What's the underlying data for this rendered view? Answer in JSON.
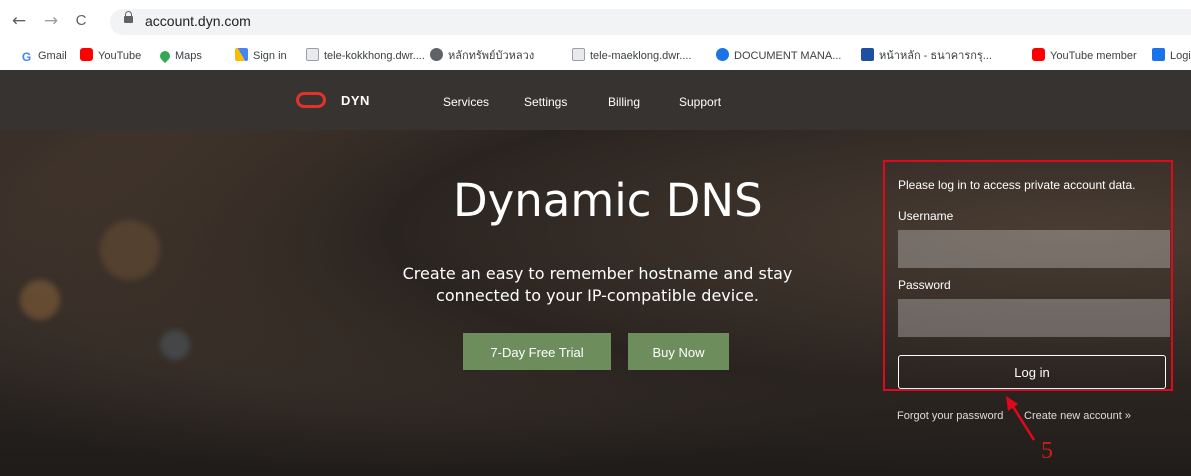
{
  "browser": {
    "url": "account.dyn.com",
    "nav": {
      "back": "←",
      "forward": "→",
      "reload": "C"
    }
  },
  "bookmarks": [
    {
      "label": "Gmail",
      "icon": "google-icon",
      "color": "#4285f4"
    },
    {
      "label": "YouTube",
      "icon": "youtube-icon",
      "color": "#ff0000"
    },
    {
      "label": "Maps",
      "icon": "maps-icon",
      "color": "#34a853"
    },
    {
      "label": "Sign in",
      "icon": "google-ads-icon",
      "color": "#4285f4"
    },
    {
      "label": "tele-kokkhong.dwr....",
      "icon": "document-icon",
      "color": "#9aa0a6"
    },
    {
      "label": "หลักทรัพย์บัวหลวง",
      "icon": "globe-icon",
      "color": "#5f6368"
    },
    {
      "label": "tele-maeklong.dwr....",
      "icon": "document-icon",
      "color": "#9aa0a6"
    },
    {
      "label": "DOCUMENT MANA...",
      "icon": "globe-icon",
      "color": "#1a73e8"
    },
    {
      "label": "หน้าหลัก - ธนาคารกรุ...",
      "icon": "bank-icon",
      "color": "#1e4fa0"
    },
    {
      "label": "YouTube member",
      "icon": "youtube-icon",
      "color": "#ff0000"
    },
    {
      "label": "Login",
      "icon": "login-icon",
      "color": "#1a73e8"
    }
  ],
  "site": {
    "logo": "DYN",
    "nav": [
      "Services",
      "Settings",
      "Billing",
      "Support"
    ],
    "hero": {
      "title": "Dynamic DNS",
      "subtitle": "Create an easy to remember hostname and stay connected to your IP-compatible device.",
      "trial_button": "7-Day Free Trial",
      "buy_button": "Buy Now"
    },
    "login": {
      "message": "Please log in to access private account data.",
      "username_label": "Username",
      "username_value": "",
      "password_label": "Password",
      "password_value": "",
      "submit": "Log in",
      "forgot": "Forgot your password",
      "create": "Create new account »"
    }
  },
  "annotation": {
    "number": "5",
    "color": "#e1081b"
  }
}
